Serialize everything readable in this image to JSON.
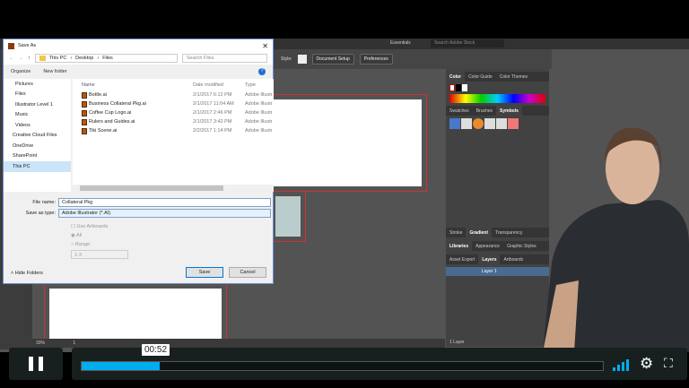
{
  "illustrator": {
    "workspace": "Essentials",
    "search_placeholder": "Search Adobe Stock",
    "style_label": "Style:",
    "document_setup": "Document Setup",
    "preferences": "Preferences",
    "color_tabs": [
      "Color",
      "Color Guide",
      "Color Themes"
    ],
    "symbol_tabs": [
      "Swatches",
      "Brushes",
      "Symbols"
    ],
    "tabs_row1": [
      "Stroke",
      "Gradient",
      "Transparency"
    ],
    "tabs_row2": [
      "Libraries",
      "Appearance",
      "Graphic Styles"
    ],
    "tabs_row3": [
      "Asset Export",
      "Layers",
      "Artboards"
    ],
    "layer_name": "Layer 1",
    "layers_count": "1 Layer",
    "zoom": "33%",
    "artboard_num": "1"
  },
  "dialog": {
    "title": "Save As",
    "breadcrumb": [
      "This PC",
      "Desktop",
      "Files"
    ],
    "search_placeholder": "Search Files",
    "organize": "Organize",
    "new_folder": "New folder",
    "nav": [
      "Pictures",
      "Files",
      "Illustrator Level 1",
      "Music",
      "Videos",
      "Creative Cloud Files",
      "OneDrive",
      "SharePoint",
      "This PC"
    ],
    "columns": [
      "Name",
      "Date modified",
      "Type"
    ],
    "files": [
      {
        "name": "Bottle.ai",
        "date": "2/1/2017 6:12 PM",
        "type": "Adobe Illustrator"
      },
      {
        "name": "Business Collateral Pkg.ai",
        "date": "2/1/2017 11:04 AM",
        "type": "Adobe Illustrator"
      },
      {
        "name": "Coffee Cup Logo.ai",
        "date": "2/1/2017 2:46 PM",
        "type": "Adobe Illustrator"
      },
      {
        "name": "Rulers and Guides.ai",
        "date": "2/1/2017 3:42 PM",
        "type": "Adobe Illustrator"
      },
      {
        "name": "Tiki Scene.ai",
        "date": "2/2/2017 1:14 PM",
        "type": "Adobe Illustrator"
      }
    ],
    "file_name_label": "File name:",
    "file_name": "Collateral Pkg",
    "save_type_label": "Save as type:",
    "save_type": "Adobe Illustrator (*.AI)",
    "use_artboards": "Use Artboards",
    "all": "All",
    "range": "Range:",
    "range_value": "1-3",
    "hide_folders": "Hide Folders",
    "save": "Save",
    "cancel": "Cancel"
  },
  "player": {
    "time": "00:52",
    "progress_percent": 15,
    "accent": "#00adef"
  }
}
